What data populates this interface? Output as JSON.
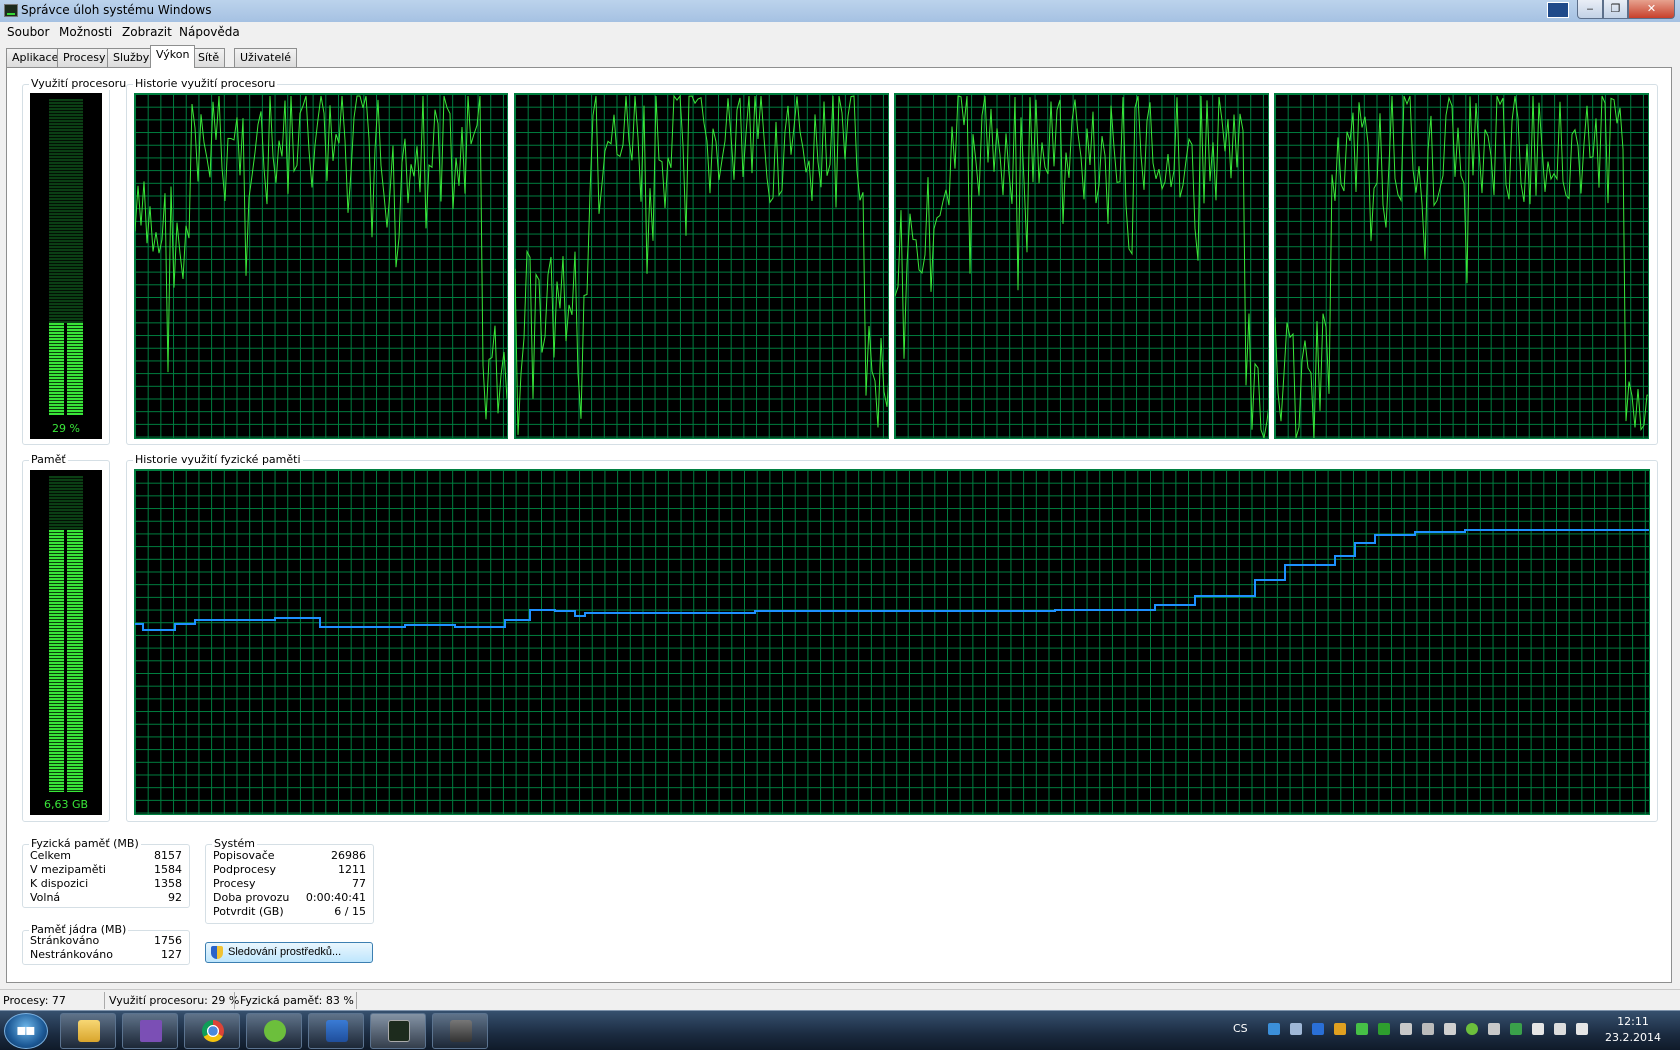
{
  "window": {
    "title": "Správce úloh systému Windows"
  },
  "menu": {
    "file": "Soubor",
    "options": "Možnosti",
    "view": "Zobrazit",
    "help": "Nápověda"
  },
  "tabs": [
    "Aplikace",
    "Procesy",
    "Služby",
    "Výkon",
    "Sítě",
    "Uživatelé"
  ],
  "active_tab": "Výkon",
  "cpu_usage": {
    "title": "Využití procesoru",
    "label": "29 %",
    "value": 0.29
  },
  "cpu_history": {
    "title": "Historie využití procesoru"
  },
  "memory": {
    "title": "Paměť",
    "label": "6,63 GB",
    "fraction": 0.83
  },
  "memory_history": {
    "title": "Historie využití fyzické paměti"
  },
  "physical_memory": {
    "title": "Fyzická paměť (MB)",
    "rows": [
      {
        "label": "Celkem",
        "value": "8157"
      },
      {
        "label": "V mezipaměti",
        "value": "1584"
      },
      {
        "label": "K dispozici",
        "value": "1358"
      },
      {
        "label": "Volná",
        "value": "92"
      }
    ]
  },
  "kernel_memory": {
    "title": "Paměť jádra (MB)",
    "rows": [
      {
        "label": "Stránkováno",
        "value": "1756"
      },
      {
        "label": "Nestránkováno",
        "value": "127"
      }
    ]
  },
  "system": {
    "title": "Systém",
    "rows": [
      {
        "label": "Popisovače",
        "value": "26986"
      },
      {
        "label": "Podprocesy",
        "value": "1211"
      },
      {
        "label": "Procesy",
        "value": "77"
      },
      {
        "label": "Doba provozu",
        "value": "0:00:40:41"
      },
      {
        "label": "Potvrdit (GB)",
        "value": "6 / 15"
      }
    ]
  },
  "resource_monitor_button": "Sledování prostředků...",
  "statusbar": {
    "processes": "Procesy: 77",
    "cpu": "Využití procesoru: 29 %",
    "memory": "Fyzická paměť: 83 %"
  },
  "taskbar": {
    "language": "CS",
    "time": "12:11",
    "date": "23.2.2014"
  },
  "colors": {
    "graph_line": "#39e639",
    "graph_grid": "#008040",
    "memory_line": "#1e90ff"
  },
  "icons": [
    "start-orb-icon",
    "explorer-icon",
    "visual-studio-icon",
    "chrome-icon",
    "utorrent-icon",
    "shield-app-icon",
    "task-manager-icon",
    "game-icon"
  ]
}
